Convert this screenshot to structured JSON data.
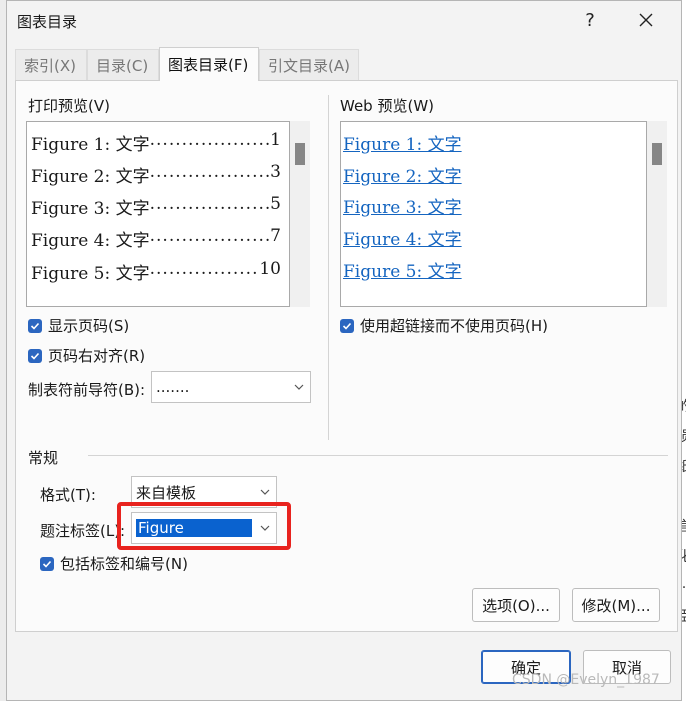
{
  "window": {
    "title": "图表目录",
    "help_label": "?"
  },
  "tabs": [
    {
      "label": "索引(X)"
    },
    {
      "label": "目录(C)"
    },
    {
      "label": "图表目录(F)"
    },
    {
      "label": "引文目录(A)"
    }
  ],
  "print_preview": {
    "label": "打印预览(V)",
    "entries": [
      {
        "label": "Figure 1: 文字",
        "dots": "......................................",
        "page": "1"
      },
      {
        "label": "Figure 2: 文字",
        "dots": "......................................",
        "page": "3"
      },
      {
        "label": "Figure 3: 文字",
        "dots": "......................................",
        "page": "5"
      },
      {
        "label": "Figure 4: 文字",
        "dots": "......................................",
        "page": "7"
      },
      {
        "label": "Figure 5: 文字",
        "dots": "......................................",
        "page": "10"
      }
    ]
  },
  "web_preview": {
    "label": "Web 预览(W)",
    "entries": [
      "Figure 1: 文字",
      "Figure 2: 文字",
      "Figure 3: 文字",
      "Figure 4: 文字",
      "Figure 5: 文字"
    ]
  },
  "options": {
    "show_page_numbers": "显示页码(S)",
    "right_align": "页码右对齐(R)",
    "tab_leader_label": "制表符前导符(B):",
    "tab_leader_value": ".......",
    "use_hyperlinks": "使用超链接而不使用页码(H)"
  },
  "general": {
    "label": "常规",
    "format_label": "格式(T):",
    "format_value": "来自模板",
    "caption_label": "题注标签(L):",
    "caption_value": "Figure",
    "include_label": "包括标签和编号(N)"
  },
  "buttons": {
    "options": "选项(O)...",
    "modify": "修改(M)...",
    "ok": "确定",
    "cancel": "取消"
  },
  "background_right": [
    "的",
    "损",
    "纸",
    "言",
    "化",
    "…",
    "臣"
  ],
  "watermark": "CSDN @Evelyn_1987",
  "colors": {
    "accent": "#2b66c0",
    "highlight_frame": "#e8231e",
    "link": "#1565c0"
  }
}
